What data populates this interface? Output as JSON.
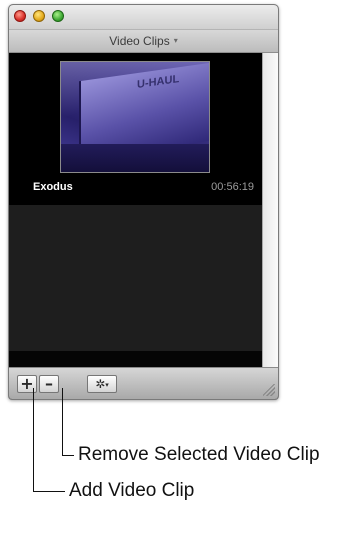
{
  "window": {
    "panel_title": "Video Clips",
    "panel_title_caret": "▾"
  },
  "clips": [
    {
      "name": "Exodus",
      "duration": "00:56:19",
      "thumbnail_text": "U-HAUL"
    }
  ],
  "toolbar": {
    "add_label": "+",
    "remove_label": "–",
    "gear_label": "✲",
    "gear_caret": "▾"
  },
  "callouts": {
    "remove": "Remove Selected Video Clip",
    "add": "Add Video Clip"
  }
}
